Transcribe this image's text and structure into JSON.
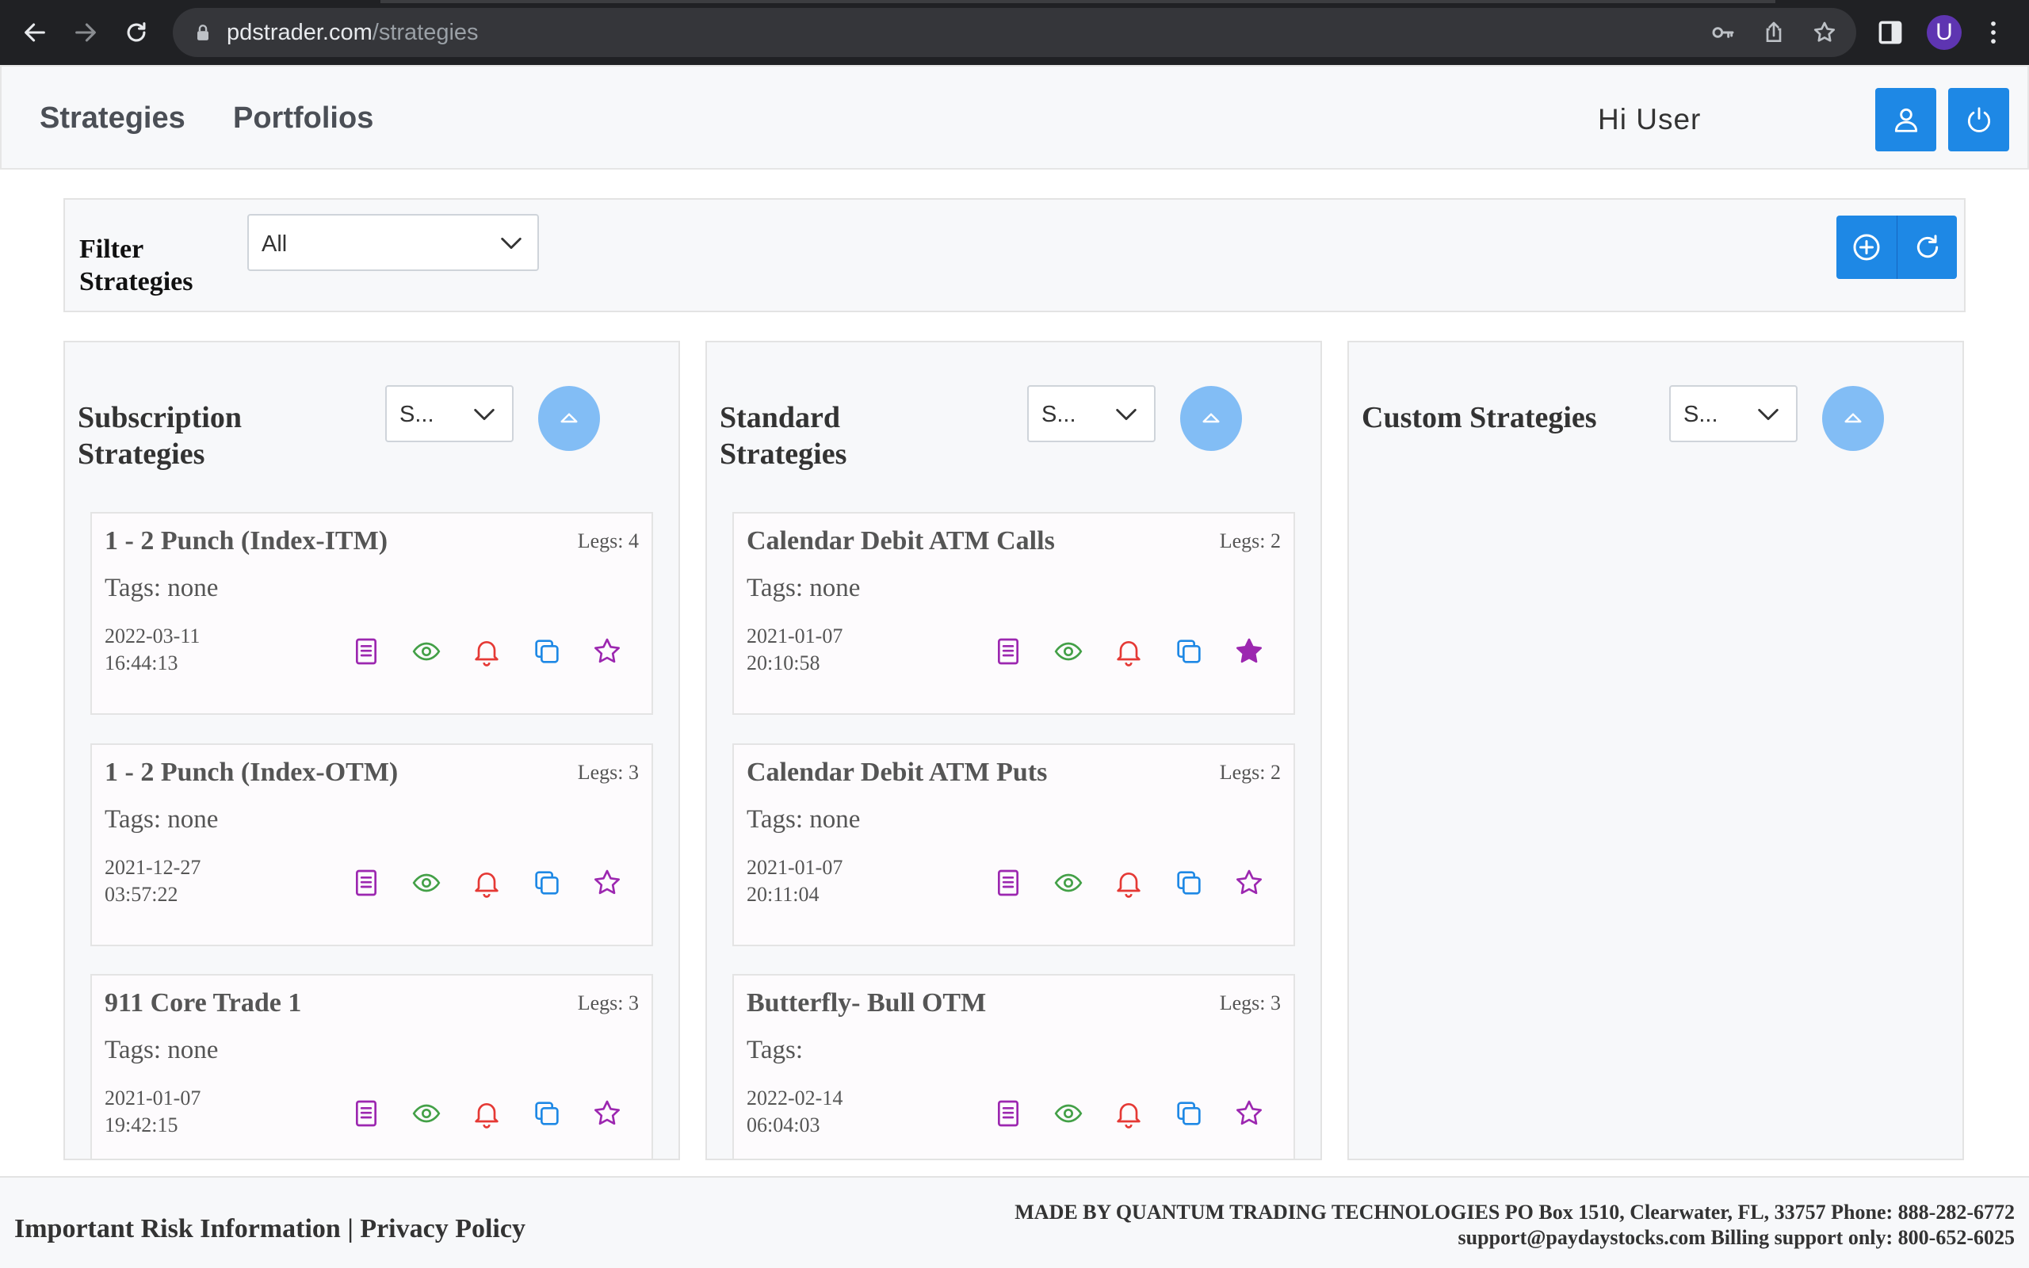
{
  "browser": {
    "url_host": "pdstrader.com",
    "url_path": "/strategies",
    "profile_initial": "U"
  },
  "header": {
    "nav": [
      "Strategies",
      "Portfolios"
    ],
    "greeting": "Hi User"
  },
  "filter": {
    "label_line1": "Filter",
    "label_line2": "Strategies",
    "selected": "All"
  },
  "columns": [
    {
      "title_line1": "Subscription",
      "title_line2": "Strategies",
      "sort_selected": "S...",
      "cards": [
        {
          "title": "1 - 2 Punch (Index-ITM)",
          "legs": "Legs: 4",
          "tags": "Tags: none",
          "date": "2022-03-11",
          "time": "16:44:13",
          "starred": false
        },
        {
          "title": "1 - 2 Punch (Index-OTM)",
          "legs": "Legs: 3",
          "tags": "Tags: none",
          "date": "2021-12-27",
          "time": "03:57:22",
          "starred": false
        },
        {
          "title": "911 Core Trade 1",
          "legs": "Legs: 3",
          "tags": "Tags: none",
          "date": "2021-01-07",
          "time": "19:42:15",
          "starred": false
        }
      ]
    },
    {
      "title_line1": "Standard",
      "title_line2": "Strategies",
      "sort_selected": "S...",
      "cards": [
        {
          "title": "Calendar Debit ATM Calls",
          "legs": "Legs: 2",
          "tags": "Tags: none",
          "date": "2021-01-07",
          "time": "20:10:58",
          "starred": true
        },
        {
          "title": "Calendar Debit ATM Puts",
          "legs": "Legs: 2",
          "tags": "Tags: none",
          "date": "2021-01-07",
          "time": "20:11:04",
          "starred": false
        },
        {
          "title": "Butterfly- Bull OTM",
          "legs": "Legs: 3",
          "tags": "Tags:",
          "date": "2022-02-14",
          "time": "06:04:03",
          "starred": false
        }
      ]
    },
    {
      "title_line1": "Custom Strategies",
      "title_line2": "",
      "sort_selected": "S...",
      "cards": []
    }
  ],
  "footer": {
    "risk_link": "Important Risk Information",
    "separator": " | ",
    "privacy_link": "Privacy Policy",
    "info_line1": "MADE BY QUANTUM TRADING TECHNOLOGIES PO Box 1510, Clearwater, FL, 33757 Phone: 888-282-6772",
    "info_line2": "support@paydaystocks.com Billing support only: 800-652-6025"
  },
  "colors": {
    "primary": "#1e88e5",
    "collapse": "#82bdf5",
    "docs_icon": "#9c27b0",
    "view_icon": "#43a047",
    "alert_icon": "#e53935",
    "copy_icon": "#1e88e5",
    "star_icon": "#9c27b0"
  },
  "icons": {
    "card": [
      "document-icon",
      "eye-icon",
      "bell-icon",
      "copy-icon",
      "star-icon"
    ]
  }
}
